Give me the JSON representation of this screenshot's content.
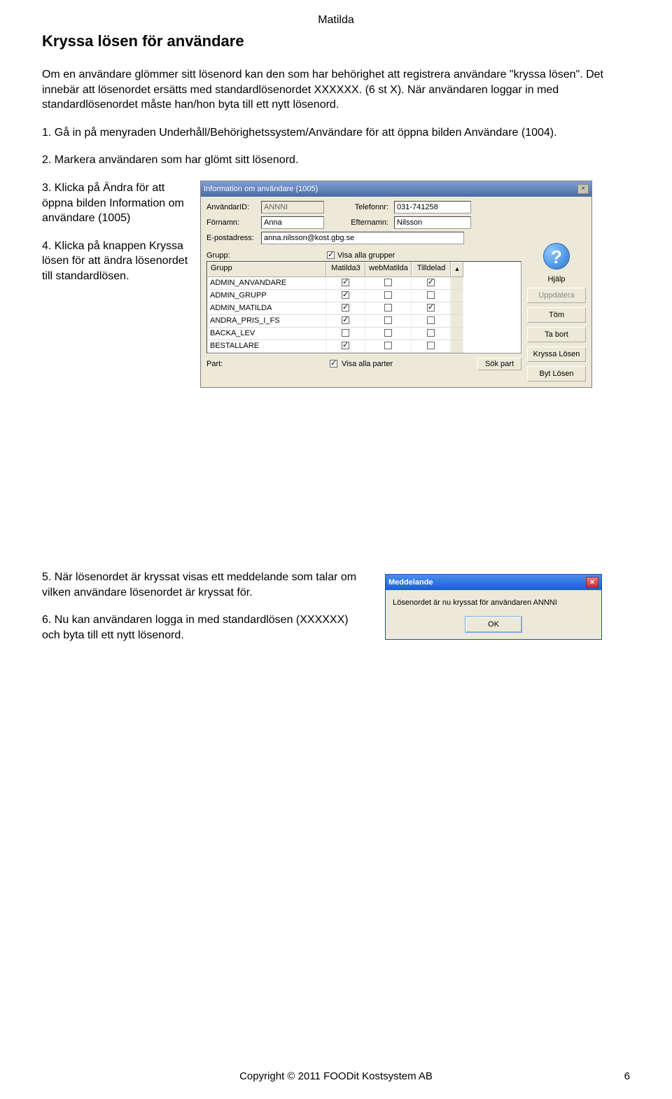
{
  "header": {
    "doc_title": "Matilda"
  },
  "heading": "Kryssa lösen för användare",
  "intro": "Om en användare glömmer sitt lösenord kan den som har behörighet att registrera användare \"kryssa lösen\". Det innebär att lösenordet ersätts med standardlösenordet XXXXXX. (6 st X). När användaren loggar in med standardlösenordet måste han/hon byta till ett nytt lösenord.",
  "step1": "1.  Gå in på menyraden Underhåll/Behörighetssystem/Användare för att öppna bilden Användare (1004).",
  "step2": "2.  Markera användaren som har glömt sitt lösenord.",
  "step3": "3.  Klicka på Ändra för att öppna bilden Information om användare (1005)",
  "step4": "4.  Klicka på knappen Kryssa lösen för att ändra lösenordet till standardlösen.",
  "step5": "5.  När lösenordet är kryssat visas ett meddelande som talar om vilken användare lösenordet är kryssat för.",
  "step6": "6.  Nu kan användaren logga in med standardlösen (XXXXXX) och byta till ett nytt lösenord.",
  "dialog": {
    "title": "Information om användare (1005)",
    "labels": {
      "anvandarID": "AnvändarID:",
      "telefonnr": "Telefonnr:",
      "fornamn": "Förnamn:",
      "efternamn": "Efternamn:",
      "epost": "E-postadress:",
      "grupp": "Grupp:",
      "visa_grupper": "Visa alla grupper",
      "part": "Part:",
      "visa_parter": "Visa alla parter"
    },
    "values": {
      "anvandarID": "ANNNI",
      "telefonnr": "031-741258",
      "fornamn": "Anna",
      "efternamn": "Nilsson",
      "epost": "anna.nilsson@kost.gbg.se"
    },
    "table": {
      "headers": {
        "grupp": "Grupp",
        "matilda3": "Matilda3",
        "webmatilda": "webMatilda",
        "tilldelad": "Tilldelad"
      },
      "rows": [
        {
          "name": "ADMIN_ANVANDARE",
          "m3": true,
          "wm": false,
          "td": true
        },
        {
          "name": "ADMIN_GRUPP",
          "m3": true,
          "wm": false,
          "td": false
        },
        {
          "name": "ADMIN_MATILDA",
          "m3": true,
          "wm": false,
          "td": true
        },
        {
          "name": "ANDRA_PRIS_I_FS",
          "m3": true,
          "wm": false,
          "td": false
        },
        {
          "name": "BACKA_LEV",
          "m3": false,
          "wm": false,
          "td": false
        },
        {
          "name": "BESTALLARE",
          "m3": true,
          "wm": false,
          "td": false
        }
      ]
    },
    "buttons": {
      "hjalp": "Hjälp",
      "uppdatera": "Uppdatera",
      "tom": "Töm",
      "tabort": "Ta bort",
      "kryssa": "Kryssa Lösen",
      "byt": "Byt Lösen",
      "sok": "Sök part"
    }
  },
  "msgbox": {
    "title": "Meddelande",
    "text": "Lösenordet är nu kryssat för användaren ANNNI",
    "ok": "OK"
  },
  "footer": {
    "copyright": "Copyright © 2011 FOODit Kostsystem AB",
    "page": "6"
  }
}
